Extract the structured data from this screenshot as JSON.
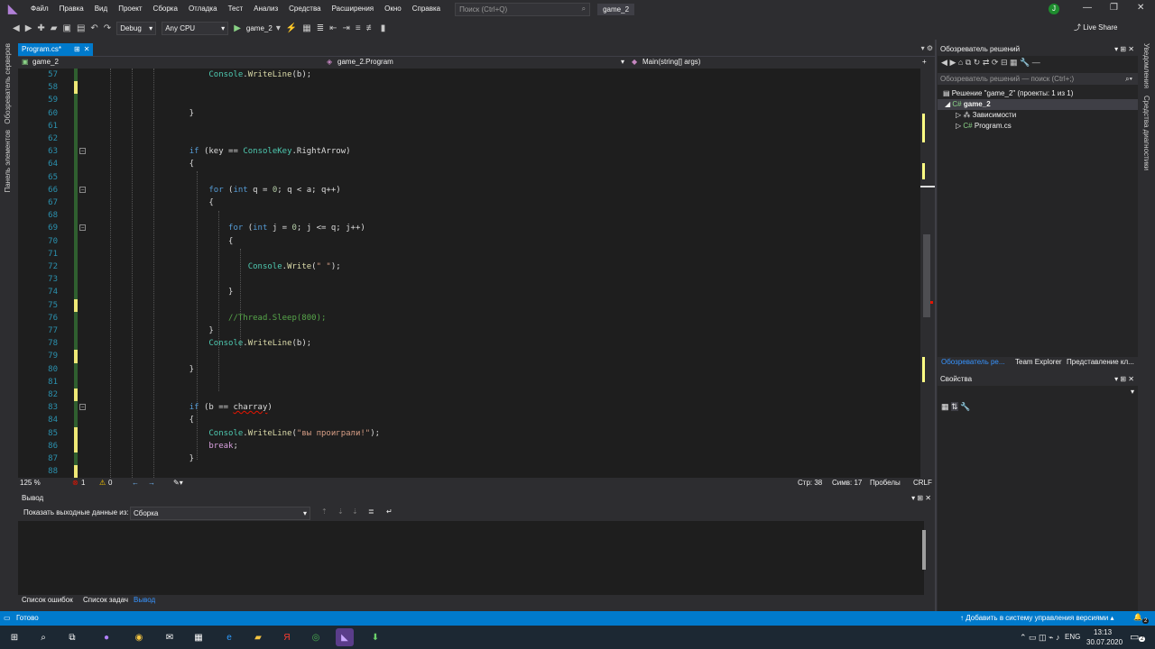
{
  "menubar": {
    "items": [
      "Файл",
      "Правка",
      "Вид",
      "Проект",
      "Сборка",
      "Отладка",
      "Тест",
      "Анализ",
      "Средства",
      "Расширения",
      "Окно",
      "Справка"
    ],
    "search_placeholder": "Поиск (Ctrl+Q)",
    "solution_name": "game_2",
    "user_initial": "J"
  },
  "toolbar": {
    "config": "Debug",
    "platform": "Any CPU",
    "start_label": "game_2",
    "live_share": "Live Share"
  },
  "sidebar_left": {
    "server_explorer": "Обозреватель серверов",
    "toolbox": "Панель элементов"
  },
  "sidebar_right": {
    "notifications": "Уведомления",
    "diagnostics": "Средства диагностики"
  },
  "editor": {
    "tab_label": "Program.cs*",
    "project": "game_2",
    "class": "game_2.Program",
    "method": "Main(string[] args)",
    "zoom": "125 %",
    "errors": "1",
    "warnings": "0",
    "line": "Стр: 38",
    "col": "Симв: 17",
    "ws": "Пробелы",
    "eol": "CRLF"
  },
  "code_lines": [
    {
      "n": "57",
      "t": "        Console.WriteLine(b);"
    },
    {
      "n": "58",
      "t": ""
    },
    {
      "n": "59",
      "t": ""
    },
    {
      "n": "60",
      "t": "    }"
    },
    {
      "n": "61",
      "t": ""
    },
    {
      "n": "62",
      "t": ""
    },
    {
      "n": "63",
      "t": "    if (key == ConsoleKey.RightArrow)"
    },
    {
      "n": "64",
      "t": "    {"
    },
    {
      "n": "65",
      "t": ""
    },
    {
      "n": "66",
      "t": "        for (int q = 0; q < a; q++)"
    },
    {
      "n": "67",
      "t": "        {"
    },
    {
      "n": "68",
      "t": ""
    },
    {
      "n": "69",
      "t": "            for (int j = 0; j <= q; j++)"
    },
    {
      "n": "70",
      "t": "            {"
    },
    {
      "n": "71",
      "t": ""
    },
    {
      "n": "72",
      "t": "                Console.Write(\" \");"
    },
    {
      "n": "73",
      "t": ""
    },
    {
      "n": "74",
      "t": "            }"
    },
    {
      "n": "75",
      "t": ""
    },
    {
      "n": "76",
      "t": "            //Thread.Sleep(800);"
    },
    {
      "n": "77",
      "t": "        }"
    },
    {
      "n": "78",
      "t": "        Console.WriteLine(b);"
    },
    {
      "n": "79",
      "t": ""
    },
    {
      "n": "80",
      "t": "    }"
    },
    {
      "n": "81",
      "t": ""
    },
    {
      "n": "82",
      "t": ""
    },
    {
      "n": "83",
      "t": "    if (b == charray)"
    },
    {
      "n": "84",
      "t": "    {"
    },
    {
      "n": "85",
      "t": "        Console.WriteLine(\"вы проиграли!\");"
    },
    {
      "n": "86",
      "t": "        break;"
    },
    {
      "n": "87",
      "t": "    }"
    },
    {
      "n": "88",
      "t": ""
    }
  ],
  "output": {
    "title": "Вывод",
    "show_from_label": "Показать выходные данные из:",
    "source": "Сборка"
  },
  "bottom_tabs": [
    "Список ошибок",
    "Список задач",
    "Вывод"
  ],
  "solution_explorer": {
    "title": "Обозреватель решений",
    "search": "Обозреватель решений — поиск (Ctrl+;)",
    "solution": "Решение \"game_2\" (проекты: 1 из 1)",
    "project": "game_2",
    "deps": "Зависимости",
    "file": "Program.cs",
    "tabs": [
      "Обозреватель ре...",
      "Team Explorer",
      "Представление кл..."
    ]
  },
  "properties": {
    "title": "Свойства"
  },
  "statusbar": {
    "ready": "Готово",
    "vcs": "Добавить в систему управления версиями",
    "bell_count": "2"
  },
  "taskbar": {
    "lang": "ENG",
    "time": "13:13",
    "date": "30.07.2020",
    "notif_count": "2"
  },
  "colors": {
    "accent": "#007acc",
    "keyword": "#569cd6",
    "class": "#4ec9b0",
    "method": "#dcdcaa",
    "string": "#d69d85",
    "comment": "#57a64a"
  }
}
